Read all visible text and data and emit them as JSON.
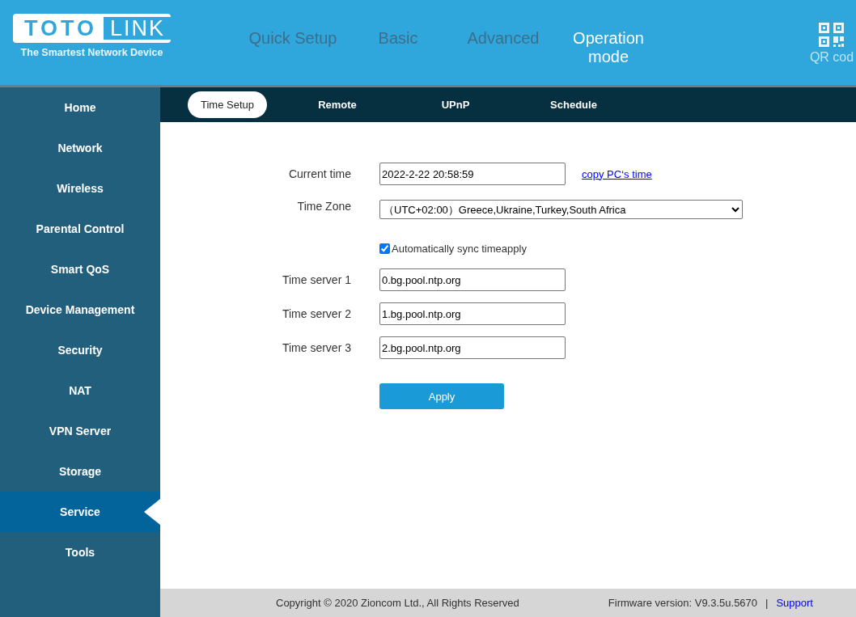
{
  "logo": {
    "word_1": "TOTO",
    "word_2": "LINK",
    "tagline": "The Smartest Network Device"
  },
  "top_nav": [
    {
      "label": "Quick Setup",
      "selected": false
    },
    {
      "label": "Basic",
      "selected": false
    },
    {
      "label": "Advanced",
      "selected": false
    },
    {
      "label": "Operation mode",
      "selected": true
    }
  ],
  "qr": {
    "label": "QR cod"
  },
  "sidebar": {
    "items": [
      {
        "label": "Home",
        "selected": false
      },
      {
        "label": "Network",
        "selected": false
      },
      {
        "label": "Wireless",
        "selected": false
      },
      {
        "label": "Parental Control",
        "selected": false
      },
      {
        "label": "Smart QoS",
        "selected": false
      },
      {
        "label": "Device Management",
        "selected": false
      },
      {
        "label": "Security",
        "selected": false
      },
      {
        "label": "NAT",
        "selected": false
      },
      {
        "label": "VPN Server",
        "selected": false
      },
      {
        "label": "Storage",
        "selected": false
      },
      {
        "label": "Service",
        "selected": true
      },
      {
        "label": "Tools",
        "selected": false
      }
    ]
  },
  "tabs": [
    {
      "label": "Time Setup",
      "selected": true
    },
    {
      "label": "Remote",
      "selected": false
    },
    {
      "label": "UPnP",
      "selected": false
    },
    {
      "label": "Schedule",
      "selected": false
    }
  ],
  "form": {
    "current_time": {
      "label": "Current time",
      "value": "2022-2-22 20:58:59",
      "link": "copy PC‘s time"
    },
    "time_zone": {
      "label": "Time Zone",
      "value": "（UTC+02:00）Greece,Ukraine,Turkey,South Africa"
    },
    "auto_sync": {
      "label": "Automatically sync timeapply",
      "checked": true
    },
    "servers": [
      {
        "label": "Time server 1",
        "value": "0.bg.pool.ntp.org"
      },
      {
        "label": "Time server 2",
        "value": "1.bg.pool.ntp.org"
      },
      {
        "label": "Time server 3",
        "value": "2.bg.pool.ntp.org"
      }
    ],
    "apply": "Apply"
  },
  "footer": {
    "copyright": "Copyright © 2020 Zioncom Ltd., All Rights Reserved",
    "firmware": "Firmware version: V9.3.5u.5670",
    "separator": "|",
    "support": "Support"
  }
}
